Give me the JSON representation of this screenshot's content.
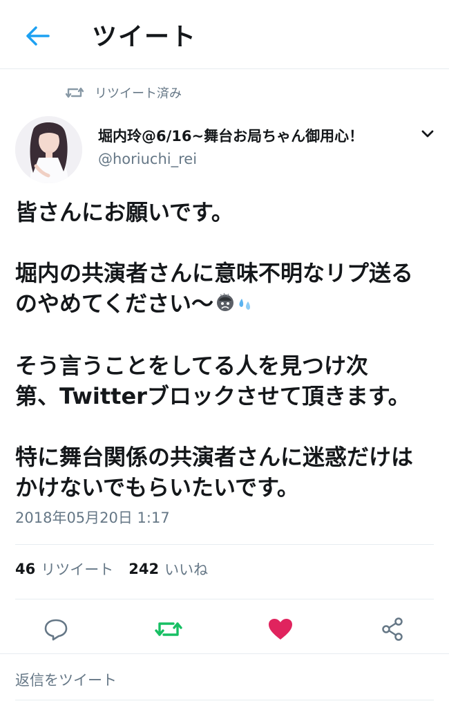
{
  "header": {
    "title": "ツイート"
  },
  "retweet_indicator": {
    "label": "リツイート済み"
  },
  "author": {
    "display_name": "堀内玲@6/16~舞台お局ちゃん御用心！",
    "handle": "@horiuchi_rei"
  },
  "tweet": {
    "lines": [
      "皆さんにお願いです。",
      "",
      "堀内の共演者さんに意味不明なリプ送る",
      "のやめてください〜",
      "",
      "そう言うことをしてる人を見つけ次",
      "第、Twitterブロックさせて頂きます。",
      "",
      "特に舞台関係の共演者さんに迷惑だけは",
      "かけないでもらいたいです。"
    ],
    "timestamp": "2018年05月20日 1:17"
  },
  "stats": {
    "retweets_count": "46",
    "retweets_label": "リツイート",
    "likes_count": "242",
    "likes_label": "いいね"
  },
  "reply_placeholder": "返信をツイート",
  "icons": {
    "back": "arrow-left-icon",
    "retweet_small": "retweet-icon",
    "caret": "chevron-down-icon",
    "emoji_face": "worried-face-emoji",
    "emoji_drops": "sweat-droplets-emoji",
    "reply": "reply-icon",
    "retweet": "retweet-icon",
    "like": "heart-icon",
    "share": "share-icon"
  },
  "colors": {
    "accent_blue": "#1da1f2",
    "retweet_green": "#17bf63",
    "like_red": "#e0245e",
    "secondary_text": "#657786",
    "primary_text": "#14171a",
    "divider": "#e6ecf0"
  }
}
